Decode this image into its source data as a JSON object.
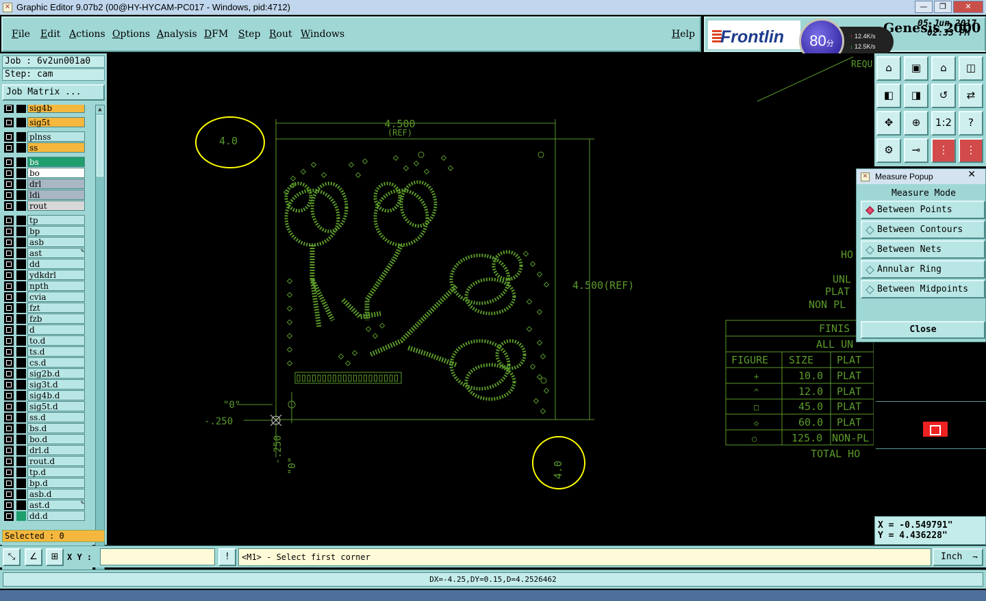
{
  "window": {
    "title": "Graphic Editor 9.07b2 (00@HY-HYCAM-PC017 - Windows, pid:4712)",
    "minimize_icon": "minimize-icon",
    "maximize_icon": "maximize-icon",
    "close_icon": "close-icon"
  },
  "menu": {
    "file": "File",
    "edit": "Edit",
    "actions": "Actions",
    "options": "Options",
    "analysis": "Analysis",
    "dfm": "DFM",
    "step": "Step",
    "rout": "Rout",
    "windows": "Windows",
    "help": "Help"
  },
  "brand": {
    "logo": "Frontlin",
    "product": "Genesis 2000",
    "date": "05 Jun 2017",
    "time": "02:33 PM",
    "accent": "#1c3b8c"
  },
  "speed_widget": {
    "value": "80",
    "unit": "分",
    "up": "12.4K/s",
    "down": "12.5K/s"
  },
  "job": {
    "job_label": "Job : 6v2un001a0",
    "step_label": "Step: cam",
    "matrix_button": "Job Matrix ..."
  },
  "layers": [
    {
      "name": "sig4b",
      "color": "#f5b73d"
    },
    {
      "name": "sig5t",
      "color": "#f5b73d"
    },
    {
      "name": "plnss",
      "color": "#b8e6e4"
    },
    {
      "name": "ss",
      "color": "#f5b73d"
    },
    {
      "name": "bs",
      "color": "#1f9e6e"
    },
    {
      "name": "bo",
      "color": "#ffffff"
    },
    {
      "name": "drl",
      "color": "#a9b7c4"
    },
    {
      "name": "ldi",
      "color": "#a9b7c4"
    },
    {
      "name": "rout",
      "color": "#d8d8d8"
    },
    {
      "name": "tp",
      "color": "#b8e6e4"
    },
    {
      "name": "bp",
      "color": "#b8e6e4"
    },
    {
      "name": "asb",
      "color": "#b8e6e4"
    },
    {
      "name": "ast",
      "color": "#b8e6e4",
      "mark": "edit"
    },
    {
      "name": "dd",
      "color": "#b8e6e4"
    },
    {
      "name": "ydkdrl",
      "color": "#b8e6e4"
    },
    {
      "name": "npth",
      "color": "#b8e6e4"
    },
    {
      "name": "cvia",
      "color": "#b8e6e4"
    },
    {
      "name": "fzt",
      "color": "#b8e6e4"
    },
    {
      "name": "fzb",
      "color": "#b8e6e4"
    },
    {
      "name": "d",
      "color": "#b8e6e4"
    },
    {
      "name": "to.d",
      "color": "#b8e6e4"
    },
    {
      "name": "ts.d",
      "color": "#b8e6e4"
    },
    {
      "name": "cs.d",
      "color": "#b8e6e4"
    },
    {
      "name": "sig2b.d",
      "color": "#b8e6e4"
    },
    {
      "name": "sig3t.d",
      "color": "#b8e6e4"
    },
    {
      "name": "sig4b.d",
      "color": "#b8e6e4"
    },
    {
      "name": "sig5t.d",
      "color": "#b8e6e4"
    },
    {
      "name": "ss.d",
      "color": "#b8e6e4"
    },
    {
      "name": "bs.d",
      "color": "#b8e6e4"
    },
    {
      "name": "bo.d",
      "color": "#b8e6e4"
    },
    {
      "name": "drl.d",
      "color": "#b8e6e4"
    },
    {
      "name": "rout.d",
      "color": "#b8e6e4"
    },
    {
      "name": "tp.d",
      "color": "#b8e6e4"
    },
    {
      "name": "bp.d",
      "color": "#b8e6e4"
    },
    {
      "name": "asb.d",
      "color": "#b8e6e4"
    },
    {
      "name": "ast.d",
      "color": "#b8e6e4",
      "mark": "edit"
    },
    {
      "name": "dd.d",
      "color": "#b8e6e4",
      "active": true
    }
  ],
  "selected_label": "Selected : 0",
  "drawing": {
    "dim_top_value": "4.500",
    "dim_top_ref": "(REF)",
    "dim_right": "4.500(REF)",
    "mark_top_left": "4.0",
    "mark_bottom_right": "4.0",
    "origin_x": "\"0\"",
    "origin_y": "\"0\"",
    "offset_x": "-.250",
    "offset_y": "-.250",
    "note_ref": "REQU",
    "note_ho": "HO",
    "note_unl": "UNL",
    "note_plat": "PLAT",
    "note_nonpl": "NON PL",
    "table": {
      "title": "FINIS",
      "subtitle": "ALL UN",
      "headers": [
        "FIGURE",
        "SIZE",
        "PLAT"
      ],
      "rows": [
        {
          "figure": "+",
          "size": "10.0",
          "plat": "PLAT"
        },
        {
          "figure": "^",
          "size": "12.0",
          "plat": "PLAT"
        },
        {
          "figure": "□",
          "size": "45.0",
          "plat": "PLAT"
        },
        {
          "figure": "◇",
          "size": "60.0",
          "plat": "PLAT"
        },
        {
          "figure": "○",
          "size": "125.0",
          "plat": "NON-PL"
        }
      ],
      "footer": "TOTAL HO"
    },
    "trace_color": "#5b9a2a",
    "highlight_color": "#ffff00"
  },
  "toolbox": {
    "icons": [
      "home-view-icon",
      "zoom-home-icon",
      "building-icon",
      "window-view-icon",
      "pan-left-icon",
      "pan-right-icon",
      "rotate-icon",
      "flip-icon",
      "fit-icon",
      "center-icon",
      "scale-1-2-icon",
      "help-icon",
      "settings-icon",
      "measure-icon",
      "layer-compare-icon",
      "layer-select-icon"
    ],
    "scale_label": "1:2",
    "help_label": "?"
  },
  "measure_popup": {
    "title": "Measure Popup",
    "mode_label": "Measure Mode",
    "options": [
      "Between Points",
      "Between Contours",
      "Between Nets",
      "Annular Ring",
      "Between Midpoints"
    ],
    "active": "Between Points",
    "close_label": "Close"
  },
  "coordinates": {
    "x_label": "X = -0.549791\"",
    "y_label": "Y = 4.436228\""
  },
  "command": {
    "xy_label": "X Y :",
    "xy_value": "",
    "prompt": "<M1> - Select first corner",
    "units": "Inch",
    "bang_label": "!"
  },
  "status": "DX=-4.25,DY=0.15,D=4.2526462"
}
